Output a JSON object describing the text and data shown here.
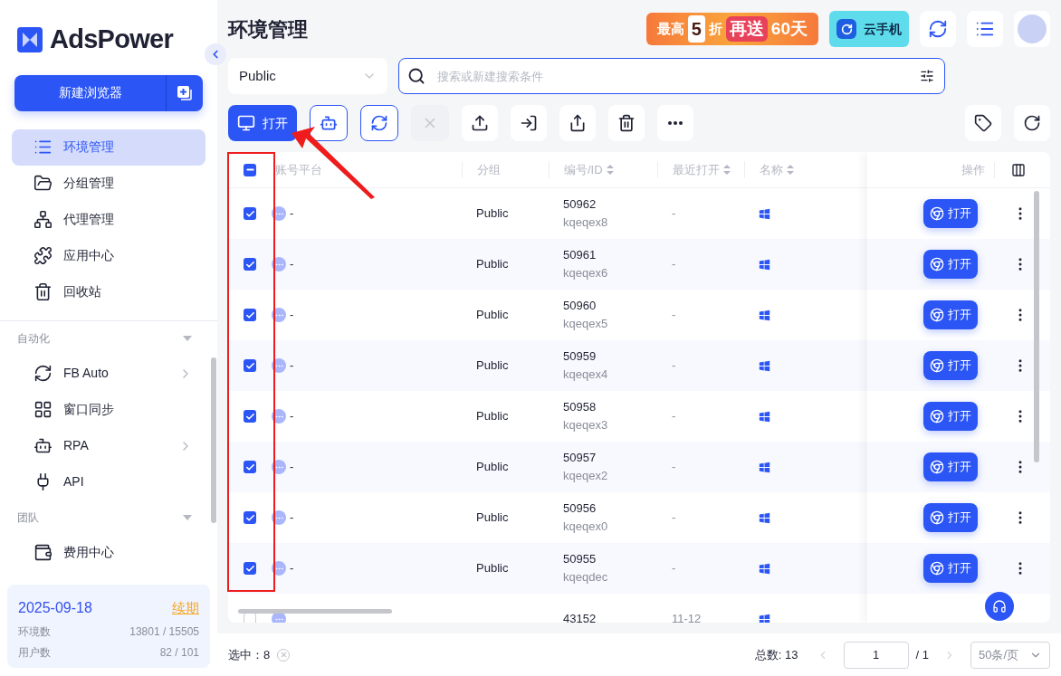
{
  "sidebar": {
    "logo": "AdsPower",
    "new_browser_button": "新建浏览器",
    "nav": [
      {
        "label": "环境管理",
        "selected": true
      },
      {
        "label": "分组管理",
        "selected": false
      },
      {
        "label": "代理管理",
        "selected": false
      },
      {
        "label": "应用中心",
        "selected": false
      },
      {
        "label": "回收站",
        "selected": false
      }
    ],
    "sections": [
      {
        "title": "自动化",
        "expanded": true,
        "items": [
          {
            "label": "FB Auto",
            "has_submenu": true
          },
          {
            "label": "窗口同步",
            "has_submenu": false
          },
          {
            "label": "RPA",
            "has_submenu": true
          },
          {
            "label": "API",
            "has_submenu": false
          }
        ]
      },
      {
        "title": "团队",
        "expanded": true,
        "items": [
          {
            "label": "费用中心",
            "has_submenu": false
          }
        ]
      }
    ],
    "subscription": {
      "expiry": "2025-09-18",
      "renew": "续期",
      "stats": [
        {
          "label": "环境数",
          "value": "13801 / 15505"
        },
        {
          "label": "用户数",
          "value": "82 / 101"
        }
      ]
    }
  },
  "header": {
    "title": "环境管理",
    "promo": {
      "parts": [
        "最高",
        "5",
        "折",
        "再送",
        "60天"
      ]
    },
    "cloud_phone": "云手机"
  },
  "filter": {
    "group": "Public",
    "search_placeholder": "搜索或新建搜索条件"
  },
  "toolbar": {
    "open_button": "打开"
  },
  "table": {
    "indeterminate": true,
    "columns": [
      {
        "label": "账号平台",
        "sortable": false
      },
      {
        "label": "分组",
        "sortable": false
      },
      {
        "label": "编号/ID",
        "sortable": true
      },
      {
        "label": "最近打开",
        "sortable": true
      },
      {
        "label": "名称",
        "sortable": true
      }
    ],
    "actions_column": "操作",
    "rows": [
      {
        "platform": "-",
        "group": "Public",
        "id": "50962",
        "serial": "kqeqex8",
        "last_opened": "-",
        "checked": true,
        "action": "打开"
      },
      {
        "platform": "-",
        "group": "Public",
        "id": "50961",
        "serial": "kqeqex6",
        "last_opened": "-",
        "checked": true,
        "action": "打开"
      },
      {
        "platform": "-",
        "group": "Public",
        "id": "50960",
        "serial": "kqeqex5",
        "last_opened": "-",
        "checked": true,
        "action": "打开"
      },
      {
        "platform": "-",
        "group": "Public",
        "id": "50959",
        "serial": "kqeqex4",
        "last_opened": "-",
        "checked": true,
        "action": "打开"
      },
      {
        "platform": "-",
        "group": "Public",
        "id": "50958",
        "serial": "kqeqex3",
        "last_opened": "-",
        "checked": true,
        "action": "打开"
      },
      {
        "platform": "-",
        "group": "Public",
        "id": "50957",
        "serial": "kqeqex2",
        "last_opened": "-",
        "checked": true,
        "action": "打开"
      },
      {
        "platform": "-",
        "group": "Public",
        "id": "50956",
        "serial": "kqeqex0",
        "last_opened": "-",
        "checked": true,
        "action": "打开"
      },
      {
        "platform": "-",
        "group": "Public",
        "id": "50955",
        "serial": "kqeqdec",
        "last_opened": "-",
        "checked": true,
        "action": "打开"
      },
      {
        "platform": "",
        "group": "",
        "id": "43152",
        "serial": "",
        "last_opened": "11-12",
        "checked": false,
        "action": ""
      }
    ]
  },
  "footer": {
    "selected_label": "选中：",
    "selected_count": "8",
    "total": "总数: 13",
    "page": "1",
    "pages": "/ 1",
    "page_size": "50条/页"
  }
}
